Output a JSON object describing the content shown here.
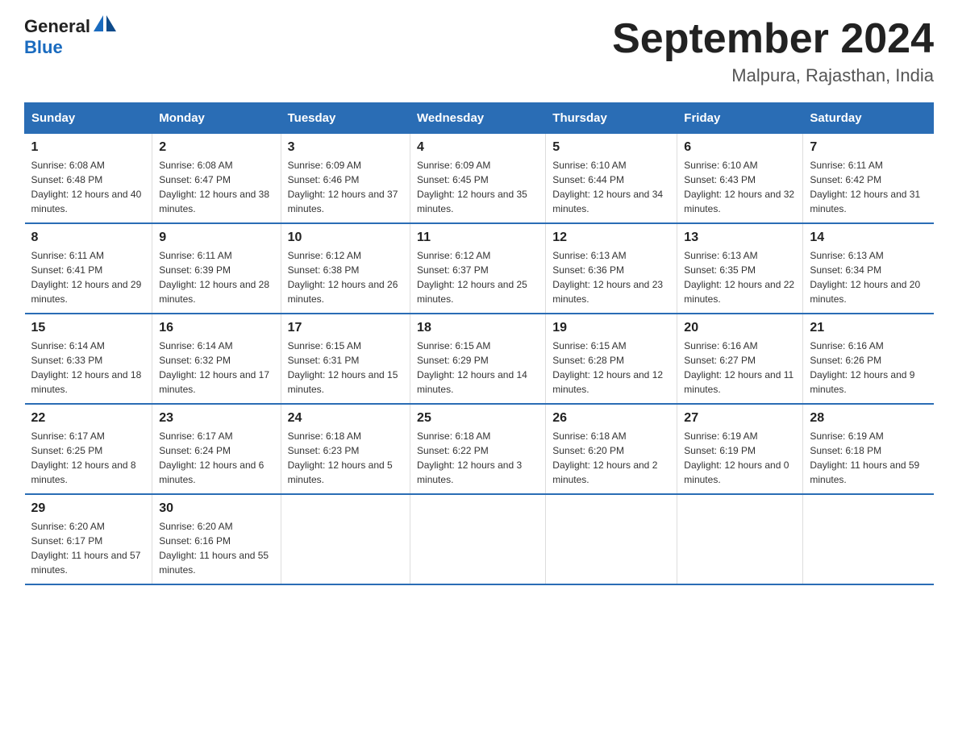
{
  "logo": {
    "text_general": "General",
    "text_blue": "Blue"
  },
  "calendar": {
    "title": "September 2024",
    "subtitle": "Malpura, Rajasthan, India"
  },
  "headers": [
    "Sunday",
    "Monday",
    "Tuesday",
    "Wednesday",
    "Thursday",
    "Friday",
    "Saturday"
  ],
  "weeks": [
    [
      {
        "day": "1",
        "sunrise": "6:08 AM",
        "sunset": "6:48 PM",
        "daylight": "12 hours and 40 minutes."
      },
      {
        "day": "2",
        "sunrise": "6:08 AM",
        "sunset": "6:47 PM",
        "daylight": "12 hours and 38 minutes."
      },
      {
        "day": "3",
        "sunrise": "6:09 AM",
        "sunset": "6:46 PM",
        "daylight": "12 hours and 37 minutes."
      },
      {
        "day": "4",
        "sunrise": "6:09 AM",
        "sunset": "6:45 PM",
        "daylight": "12 hours and 35 minutes."
      },
      {
        "day": "5",
        "sunrise": "6:10 AM",
        "sunset": "6:44 PM",
        "daylight": "12 hours and 34 minutes."
      },
      {
        "day": "6",
        "sunrise": "6:10 AM",
        "sunset": "6:43 PM",
        "daylight": "12 hours and 32 minutes."
      },
      {
        "day": "7",
        "sunrise": "6:11 AM",
        "sunset": "6:42 PM",
        "daylight": "12 hours and 31 minutes."
      }
    ],
    [
      {
        "day": "8",
        "sunrise": "6:11 AM",
        "sunset": "6:41 PM",
        "daylight": "12 hours and 29 minutes."
      },
      {
        "day": "9",
        "sunrise": "6:11 AM",
        "sunset": "6:39 PM",
        "daylight": "12 hours and 28 minutes."
      },
      {
        "day": "10",
        "sunrise": "6:12 AM",
        "sunset": "6:38 PM",
        "daylight": "12 hours and 26 minutes."
      },
      {
        "day": "11",
        "sunrise": "6:12 AM",
        "sunset": "6:37 PM",
        "daylight": "12 hours and 25 minutes."
      },
      {
        "day": "12",
        "sunrise": "6:13 AM",
        "sunset": "6:36 PM",
        "daylight": "12 hours and 23 minutes."
      },
      {
        "day": "13",
        "sunrise": "6:13 AM",
        "sunset": "6:35 PM",
        "daylight": "12 hours and 22 minutes."
      },
      {
        "day": "14",
        "sunrise": "6:13 AM",
        "sunset": "6:34 PM",
        "daylight": "12 hours and 20 minutes."
      }
    ],
    [
      {
        "day": "15",
        "sunrise": "6:14 AM",
        "sunset": "6:33 PM",
        "daylight": "12 hours and 18 minutes."
      },
      {
        "day": "16",
        "sunrise": "6:14 AM",
        "sunset": "6:32 PM",
        "daylight": "12 hours and 17 minutes."
      },
      {
        "day": "17",
        "sunrise": "6:15 AM",
        "sunset": "6:31 PM",
        "daylight": "12 hours and 15 minutes."
      },
      {
        "day": "18",
        "sunrise": "6:15 AM",
        "sunset": "6:29 PM",
        "daylight": "12 hours and 14 minutes."
      },
      {
        "day": "19",
        "sunrise": "6:15 AM",
        "sunset": "6:28 PM",
        "daylight": "12 hours and 12 minutes."
      },
      {
        "day": "20",
        "sunrise": "6:16 AM",
        "sunset": "6:27 PM",
        "daylight": "12 hours and 11 minutes."
      },
      {
        "day": "21",
        "sunrise": "6:16 AM",
        "sunset": "6:26 PM",
        "daylight": "12 hours and 9 minutes."
      }
    ],
    [
      {
        "day": "22",
        "sunrise": "6:17 AM",
        "sunset": "6:25 PM",
        "daylight": "12 hours and 8 minutes."
      },
      {
        "day": "23",
        "sunrise": "6:17 AM",
        "sunset": "6:24 PM",
        "daylight": "12 hours and 6 minutes."
      },
      {
        "day": "24",
        "sunrise": "6:18 AM",
        "sunset": "6:23 PM",
        "daylight": "12 hours and 5 minutes."
      },
      {
        "day": "25",
        "sunrise": "6:18 AM",
        "sunset": "6:22 PM",
        "daylight": "12 hours and 3 minutes."
      },
      {
        "day": "26",
        "sunrise": "6:18 AM",
        "sunset": "6:20 PM",
        "daylight": "12 hours and 2 minutes."
      },
      {
        "day": "27",
        "sunrise": "6:19 AM",
        "sunset": "6:19 PM",
        "daylight": "12 hours and 0 minutes."
      },
      {
        "day": "28",
        "sunrise": "6:19 AM",
        "sunset": "6:18 PM",
        "daylight": "11 hours and 59 minutes."
      }
    ],
    [
      {
        "day": "29",
        "sunrise": "6:20 AM",
        "sunset": "6:17 PM",
        "daylight": "11 hours and 57 minutes."
      },
      {
        "day": "30",
        "sunrise": "6:20 AM",
        "sunset": "6:16 PM",
        "daylight": "11 hours and 55 minutes."
      },
      null,
      null,
      null,
      null,
      null
    ]
  ]
}
